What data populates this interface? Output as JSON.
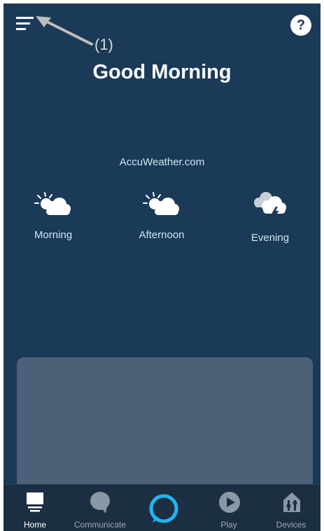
{
  "annotation": {
    "label": "(1)"
  },
  "header": {
    "greeting": "Good Morning",
    "help_label": "?"
  },
  "weather": {
    "source": "AccuWeather.com",
    "periods": [
      {
        "label": "Morning",
        "icon": "partly-sunny-icon"
      },
      {
        "label": "Afternoon",
        "icon": "partly-sunny-icon"
      },
      {
        "label": "Evening",
        "icon": "thunderstorm-icon"
      }
    ]
  },
  "bottom_nav": {
    "items": [
      {
        "label": "Home",
        "icon": "home-icon",
        "active": true
      },
      {
        "label": "Communicate",
        "icon": "speech-bubble-icon",
        "active": false
      },
      {
        "label": "",
        "icon": "alexa-ring-icon",
        "active": false
      },
      {
        "label": "Play",
        "icon": "play-icon",
        "active": false
      },
      {
        "label": "Devices",
        "icon": "devices-icon",
        "active": false
      }
    ]
  },
  "colors": {
    "background": "#1a3a57",
    "card": "#4c6178",
    "accent": "#1fb6f0"
  }
}
